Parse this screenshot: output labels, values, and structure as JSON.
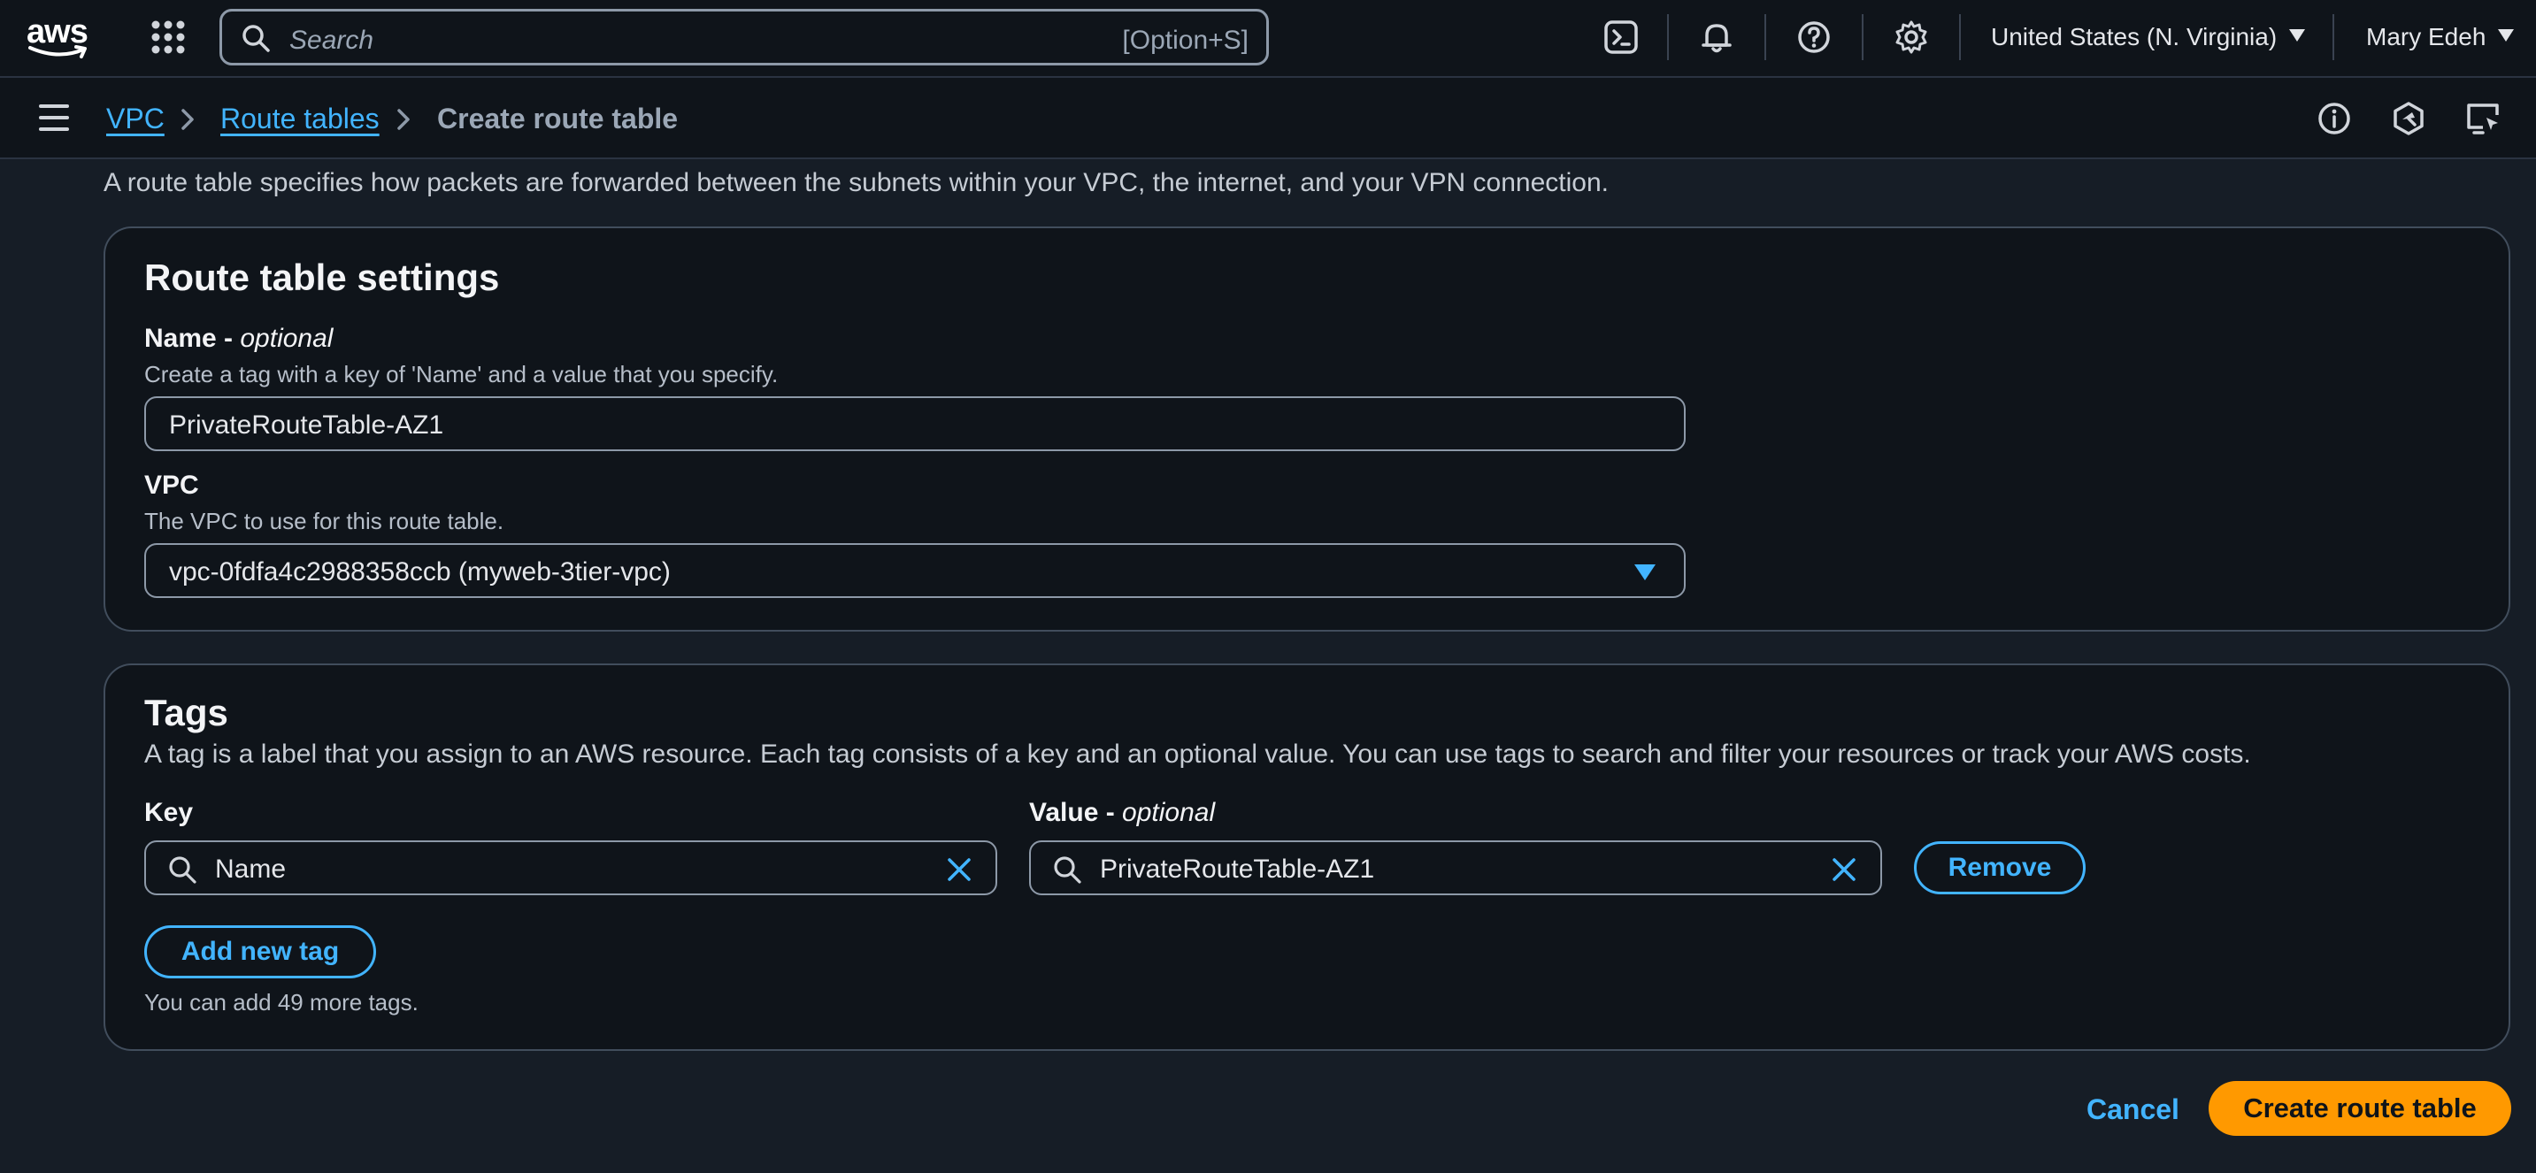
{
  "topnav": {
    "logo_text": "aws",
    "search_placeholder": "Search",
    "search_shortcut": "[Option+S]",
    "region": "United States (N. Virginia)",
    "user": "Mary Edeh"
  },
  "breadcrumbs": {
    "items": [
      "VPC",
      "Route tables"
    ],
    "current": "Create route table"
  },
  "intro": "A route table specifies how packets are forwarded between the subnets within your VPC, the internet, and your VPN connection.",
  "settings": {
    "heading": "Route table settings",
    "name_label": "Name - ",
    "name_optional": "optional",
    "name_desc": "Create a tag with a key of 'Name' and a value that you specify.",
    "name_value": "PrivateRouteTable-AZ1",
    "vpc_label": "VPC",
    "vpc_desc": "The VPC to use for this route table.",
    "vpc_value": "vpc-0fdfa4c2988358ccb (myweb-3tier-vpc)"
  },
  "tags": {
    "heading": "Tags",
    "desc": "A tag is a label that you assign to an AWS resource. Each tag consists of a key and an optional value. You can use tags to search and filter your resources or track your AWS costs.",
    "key_label": "Key",
    "value_label": "Value - ",
    "value_optional": "optional",
    "key_value": "Name",
    "value_value": "PrivateRouteTable-AZ1",
    "remove_label": "Remove",
    "add_label": "Add new tag",
    "help": "You can add 49 more tags."
  },
  "footer": {
    "cancel_label": "Cancel",
    "submit_label": "Create route table"
  },
  "colors": {
    "accent": "#42b4ff",
    "primary_button": "#ff9900",
    "background": "#161d26"
  }
}
